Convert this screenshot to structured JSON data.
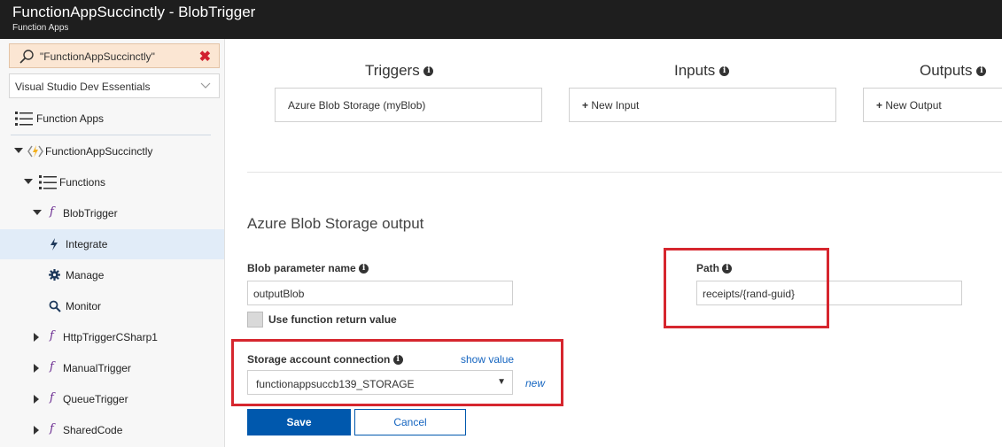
{
  "header": {
    "title": "FunctionAppSuccinctly - BlobTrigger",
    "subtitle": "Function Apps"
  },
  "sidebar": {
    "search_value": "\"FunctionAppSuccinctly\"",
    "subscription": "Visual Studio Dev Essentials",
    "items": {
      "function_apps": "Function Apps",
      "app": "FunctionAppSuccinctly",
      "functions": "Functions",
      "blob_trigger": "BlobTrigger",
      "integrate": "Integrate",
      "manage": "Manage",
      "monitor": "Monitor",
      "http_trigger": "HttpTriggerCSharp1",
      "manual_trigger": "ManualTrigger",
      "queue_trigger": "QueueTrigger",
      "shared_code": "SharedCode"
    },
    "selected": "Integrate"
  },
  "main": {
    "columns": {
      "triggers": "Triggers",
      "inputs": "Inputs",
      "outputs": "Outputs"
    },
    "trigger_box": "Azure Blob Storage (myBlob)",
    "new_input": "New Input",
    "new_output": "New Output",
    "section_title": "Azure Blob Storage output",
    "blob_param_label": "Blob parameter name",
    "blob_param_value": "outputBlob",
    "use_return_label": "Use function return value",
    "path_label": "Path",
    "path_value": "receipts/{rand-guid}",
    "storage_label": "Storage account connection",
    "show_value": "show value",
    "storage_value": "functionappsuccb139_STORAGE",
    "new_link": "new",
    "save": "Save",
    "cancel": "Cancel"
  },
  "colors": {
    "highlight": "#d6262e",
    "accent": "#0058ad",
    "selected_row": "#e1ecf8",
    "header_bg": "#1e1e1e"
  }
}
